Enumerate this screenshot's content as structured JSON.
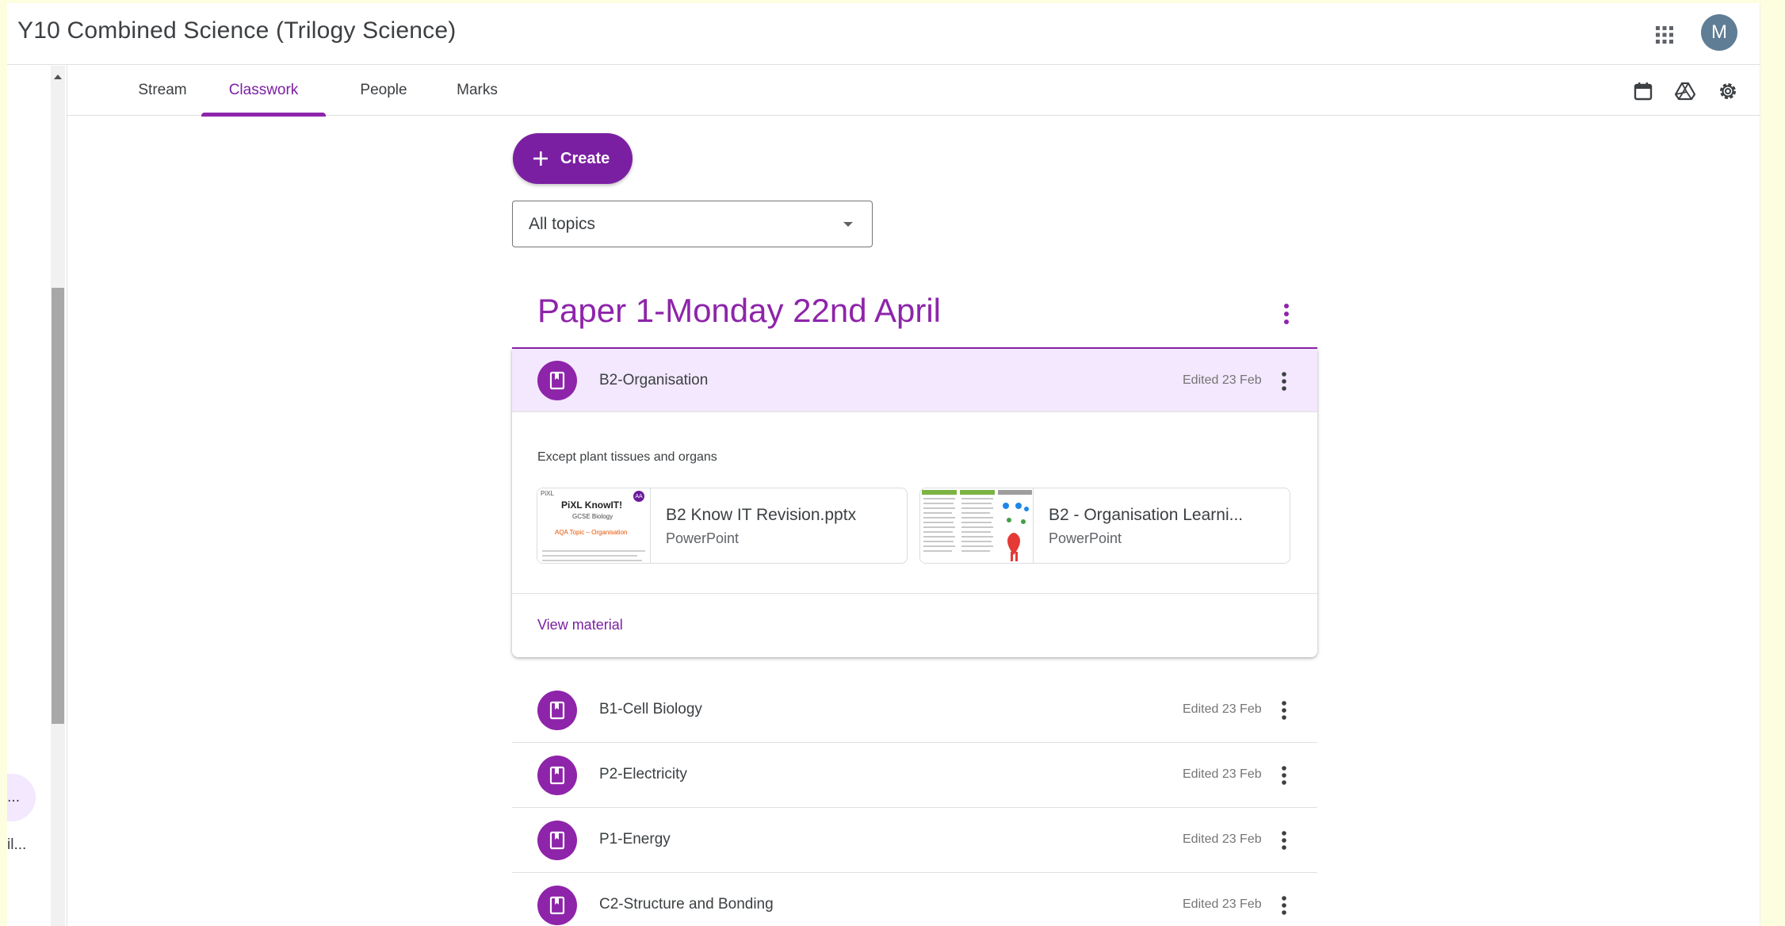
{
  "header": {
    "class_title": "Y10 Combined Science (Trilogy Science)",
    "avatar_letter": "M"
  },
  "tabs": [
    {
      "label": "Stream",
      "active": false
    },
    {
      "label": "Classwork",
      "active": true
    },
    {
      "label": "People",
      "active": false
    },
    {
      "label": "Marks",
      "active": false
    }
  ],
  "left_rail": {
    "item1": "ri...",
    "item2": "il..."
  },
  "toolbar": {
    "create_label": "Create",
    "topic_filter_value": "All topics"
  },
  "topic": {
    "title": "Paper 1-Monday 22nd April",
    "expanded_item": {
      "title": "B2-Organisation",
      "edited": "Edited 23 Feb",
      "description": "Except plant tissues and organs",
      "attachments": [
        {
          "title": "B2 Know IT Revision.pptx",
          "type": "PowerPoint",
          "thumb_text_1": "PiXL",
          "thumb_text_2": "PiXL KnowIT!",
          "thumb_text_3": "GCSE Biology",
          "thumb_text_4": "AQA Topic – Organisation",
          "thumb_badge": "AA"
        },
        {
          "title": "B2 - Organisation Learni...",
          "type": "PowerPoint"
        }
      ],
      "view_label": "View material"
    },
    "items": [
      {
        "title": "B1-Cell Biology",
        "edited": "Edited 23 Feb"
      },
      {
        "title": "P2-Electricity",
        "edited": "Edited 23 Feb"
      },
      {
        "title": "P1-Energy",
        "edited": "Edited 23 Feb"
      },
      {
        "title": "C2-Structure and Bonding",
        "edited": "Edited 23 Feb"
      }
    ]
  },
  "colors": {
    "accent": "#8e24aa",
    "accent_dark": "#7b1fa2",
    "header_tint": "#f3e8fd",
    "avatar": "#5f7d95"
  }
}
